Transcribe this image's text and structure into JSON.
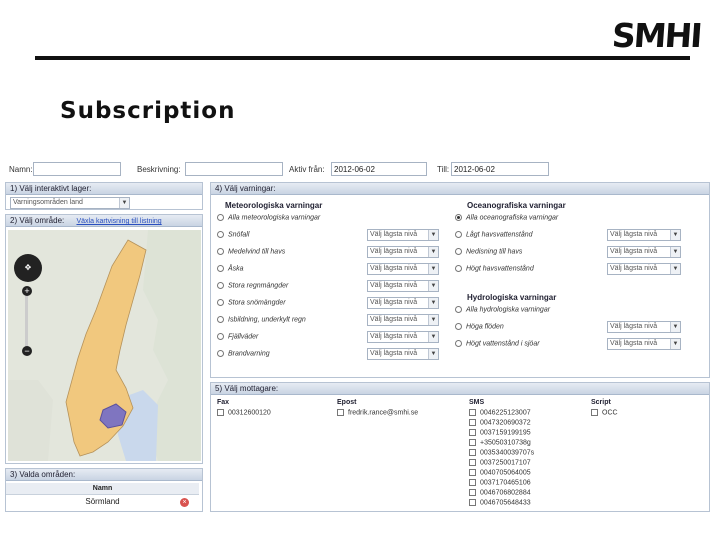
{
  "slide": {
    "logo": "SMHI",
    "title": "Subscription"
  },
  "fields": {
    "name_label": "Namn:",
    "name_value": "",
    "description_label": "Beskrivning:",
    "description_value": "",
    "active_from_label": "Aktiv från:",
    "active_from_value": "2012-06-02",
    "to_label": "Till:",
    "to_value": "2012-06-02"
  },
  "layers_panel": {
    "title": "1) Välj interaktivt lager:",
    "selected_layer": "Varningsområden land"
  },
  "area_panel": {
    "title": "2) Välj område:",
    "link": "Växla kartvisning till listning"
  },
  "selected_areas_panel": {
    "title": "3) Valda områden:",
    "column": "Namn",
    "rows": [
      "Sörmland"
    ]
  },
  "warnings_panel": {
    "title": "4) Välj varningar:",
    "meteo_title": "Meteorologiska varningar",
    "meteo_items": [
      {
        "label": "Alla meteorologiska varningar",
        "level": ""
      },
      {
        "label": "Snöfall",
        "level": "Välj lägsta nivå"
      },
      {
        "label": "Medelvind till havs",
        "level": "Välj lägsta nivå"
      },
      {
        "label": "Åska",
        "level": "Välj lägsta nivå"
      },
      {
        "label": "Stora regnmängder",
        "level": "Välj lägsta nivå"
      },
      {
        "label": "Stora snömängder",
        "level": "Välj lägsta nivå"
      },
      {
        "label": "Isbildning, underkylt regn",
        "level": "Välj lägsta nivå"
      },
      {
        "label": "Fjällväder",
        "level": "Välj lägsta nivå"
      },
      {
        "label": "Brandvarning",
        "level": "Välj lägsta nivå"
      }
    ],
    "ocean_title": "Oceanografiska varningar",
    "ocean_items": [
      {
        "label": "Alla oceanografiska varningar",
        "level": "",
        "selected": true
      },
      {
        "label": "Lågt havsvattenstånd",
        "level": "Välj lägsta nivå",
        "selected": false
      },
      {
        "label": "Nedisning till havs",
        "level": "Välj lägsta nivå",
        "selected": false
      },
      {
        "label": "Högt havsvattenstånd",
        "level": "Välj lägsta nivå",
        "selected": false
      }
    ],
    "hydro_title": "Hydrologiska varningar",
    "hydro_items": [
      {
        "label": "Alla hydrologiska varningar",
        "level": ""
      },
      {
        "label": "Höga flöden",
        "level": "Välj lägsta nivå"
      },
      {
        "label": "Högt vattenstånd i sjöar",
        "level": "Välj lägsta nivå"
      }
    ]
  },
  "recipients_panel": {
    "title": "5) Välj mottagare:",
    "fax_header": "Fax",
    "fax_items": [
      "00312600120"
    ],
    "email_header": "Epost",
    "email_items": [
      "fredrik.rance@smhi.se"
    ],
    "sms_header": "SMS",
    "sms_items": [
      "0046225123007",
      "0047320690372",
      "0037159199195",
      "+35050310738g",
      "0035340039707s",
      "0037250017107",
      "0040705064005",
      "0037170465106",
      "0046706802884",
      "0046705648433"
    ],
    "script_header": "Script",
    "script_items": [
      "OCC"
    ]
  },
  "colors": {
    "panel_header": "#c9d4e3",
    "land": "#f1c87e",
    "selected_area": "#5a5ad6",
    "water": "#c9d8ec"
  }
}
